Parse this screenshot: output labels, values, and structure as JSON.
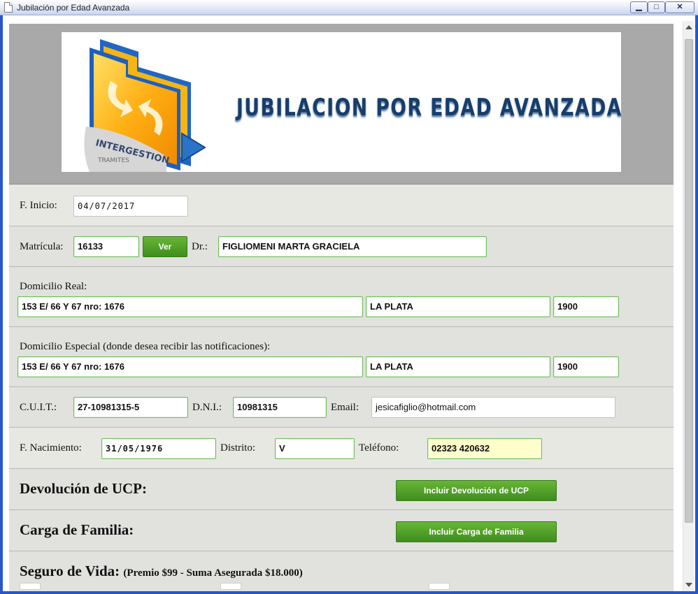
{
  "window": {
    "title": "Jubilación por Edad Avanzada",
    "controls": {
      "minimize": "▁",
      "maximize": "□",
      "close": "✕"
    }
  },
  "banner": {
    "logo_text_1": "INTERGESTION",
    "logo_text_2": "TRAMITES",
    "title": "JUBILACION POR EDAD AVANZADA"
  },
  "form": {
    "inicio": {
      "label": "F. Inicio:",
      "value": "04/07/2017"
    },
    "matricula": {
      "label": "Matrícula:",
      "value": "16133",
      "ver_label": "Ver"
    },
    "doctor": {
      "label": "Dr.:",
      "value": "FIGLIOMENI MARTA GRACIELA"
    },
    "domicilio_real": {
      "label": "Domicilio Real:",
      "address": "153 E/ 66 Y 67 nro: 1676",
      "city": "LA PLATA",
      "zip": "1900"
    },
    "domicilio_especial": {
      "label": "Domicilio Especial (donde desea recibir las notificaciones):",
      "address": "153 E/ 66 Y 67 nro: 1676",
      "city": "LA PLATA",
      "zip": "1900"
    },
    "cuit": {
      "label": "C.U.I.T.:",
      "value": "27-10981315-5"
    },
    "dni": {
      "label": "D.N.I.:",
      "value": "10981315"
    },
    "email": {
      "label": "Email:",
      "value": "jesicafiglio@hotmail.com"
    },
    "nacimiento": {
      "label": "F. Nacimiento:",
      "value": "31/05/1976"
    },
    "distrito": {
      "label": "Distrito:",
      "value": "V"
    },
    "telefono": {
      "label": "Teléfono:",
      "value": "02323 420632"
    },
    "ucp": {
      "label": "Devolución de UCP:",
      "button": "Incluir Devolución de UCP"
    },
    "familia": {
      "label": "Carga de Familia:",
      "button": "Incluir Carga de Familia"
    },
    "seguro": {
      "label": "Seguro de Vida:",
      "detail": "(Premio $99 - Suma Asegurada $18.000)"
    }
  },
  "colors": {
    "accent_green": "#4f9e28",
    "field_border": "#6fbe5b",
    "highlight_field": "#ffffcc"
  }
}
